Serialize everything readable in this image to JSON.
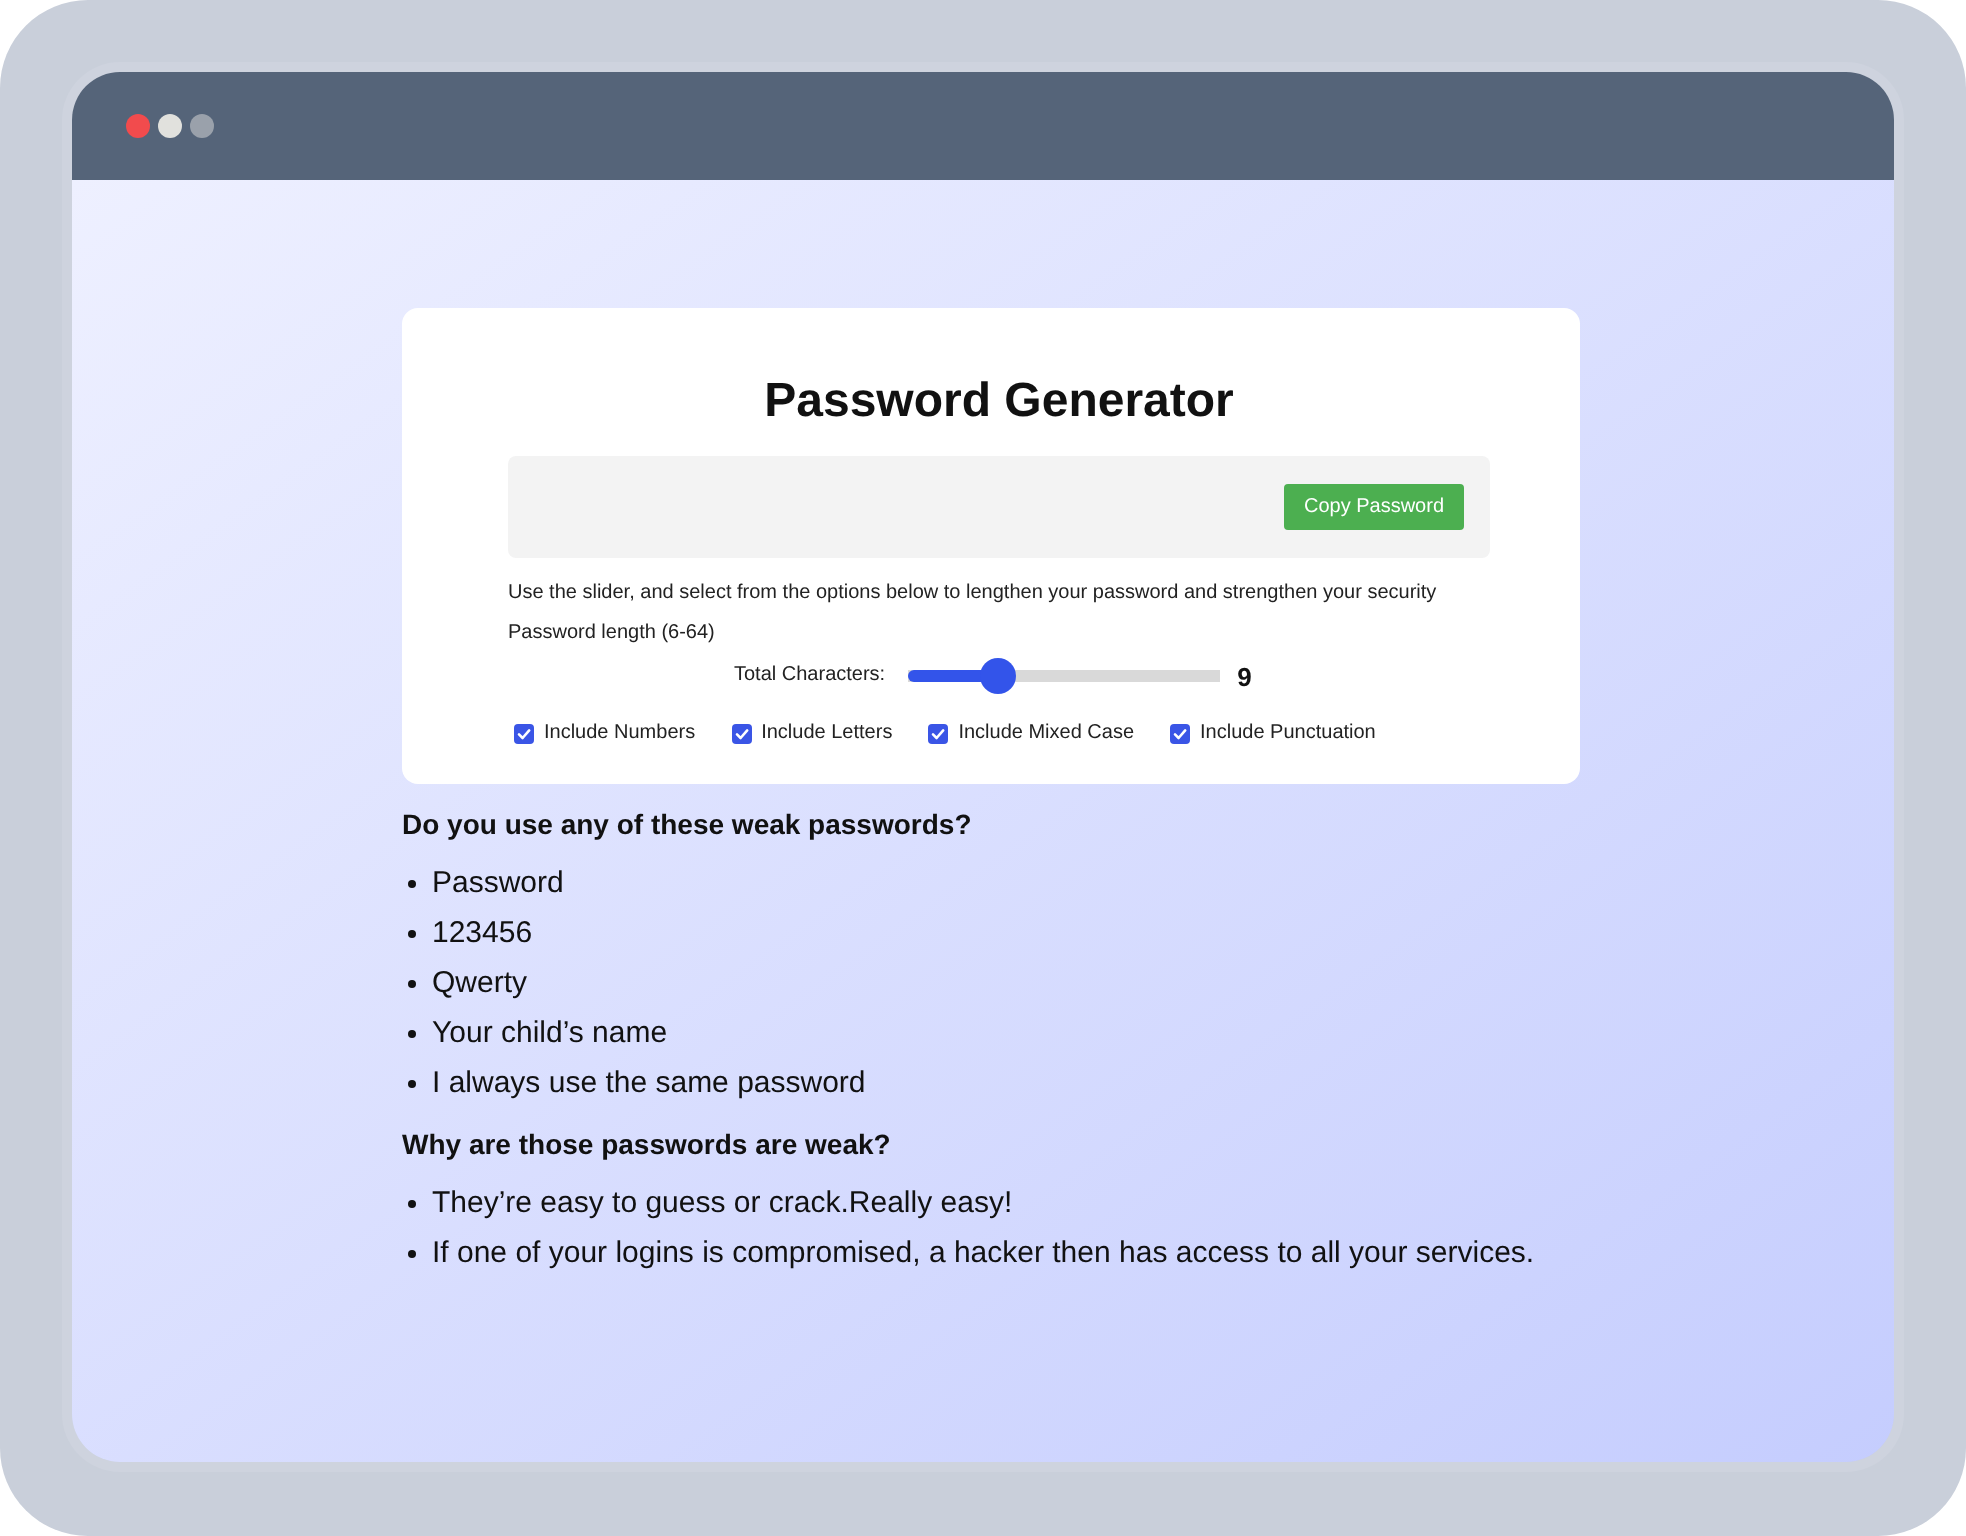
{
  "window": {
    "controls": [
      {
        "color": "#f24b4d"
      },
      {
        "color": "#e1e1dd"
      },
      {
        "color": "#9aa1ab"
      }
    ]
  },
  "card": {
    "title": "Password Generator",
    "copy_button": "Copy Password",
    "instructions": "Use the slider, and select from the options below to lengthen your password and strengthen your security",
    "length_label": "Password length (6-64)",
    "slider": {
      "label": "Total Characters:",
      "level": 0.29,
      "reading": "9"
    },
    "options": [
      {
        "label": "Include Numbers",
        "checked": true
      },
      {
        "label": "Include Letters",
        "checked": true
      },
      {
        "label": "Include Mixed Case",
        "checked": true
      },
      {
        "label": "Include Punctuation",
        "checked": true
      }
    ]
  },
  "sections": [
    {
      "heading": "Do you use any of these weak passwords?",
      "items": [
        "Password",
        "123456",
        "Qwerty",
        "Your child’s name",
        "I always use the same password"
      ]
    },
    {
      "heading": "Why are those passwords are weak?",
      "items": [
        "They’re easy to guess or crack.Really easy!",
        "If one of your logins is compromised, a hacker then has access to all your services."
      ]
    }
  ]
}
